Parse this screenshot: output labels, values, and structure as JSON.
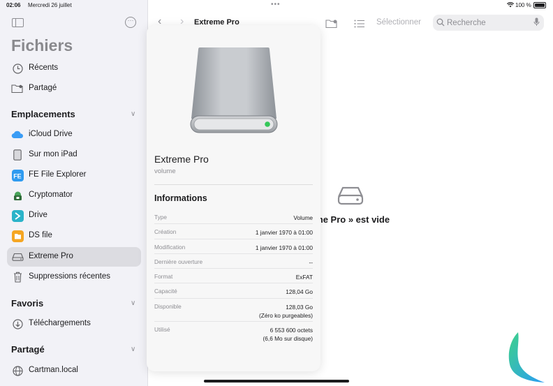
{
  "status": {
    "time": "02:06",
    "date": "Mercredi 26 juillet",
    "battery": "100 %",
    "battery_level": 1.0
  },
  "sidebar": {
    "title": "Fichiers",
    "top_items": [
      {
        "label": "Récents",
        "icon": "clock-icon"
      },
      {
        "label": "Partagé",
        "icon": "shared-folder-icon"
      }
    ],
    "sections": {
      "locations": {
        "title": "Emplacements",
        "items": [
          {
            "label": "iCloud Drive",
            "icon": "icloud-icon"
          },
          {
            "label": "Sur mon iPad",
            "icon": "ipad-icon"
          },
          {
            "label": "FE File Explorer",
            "icon": "fe-app-icon"
          },
          {
            "label": "Cryptomator",
            "icon": "cryptomator-icon"
          },
          {
            "label": "Drive",
            "icon": "drive-app-icon"
          },
          {
            "label": "DS file",
            "icon": "ds-file-icon"
          },
          {
            "label": "Extreme Pro",
            "icon": "external-drive-icon",
            "selected": true
          },
          {
            "label": "Suppressions récentes",
            "icon": "trash-icon"
          }
        ]
      },
      "favorites": {
        "title": "Favoris",
        "items": [
          {
            "label": "Téléchargements",
            "icon": "download-icon"
          }
        ]
      },
      "shared": {
        "title": "Partagé",
        "items": [
          {
            "label": "Cartman.local",
            "icon": "network-icon"
          }
        ]
      }
    }
  },
  "toolbar": {
    "title": "Extreme Pro",
    "select_label": "Sélectionner",
    "search_placeholder": "Recherche"
  },
  "main": {
    "empty_message": "eme Pro » est vide"
  },
  "popover": {
    "name": "Extreme Pro",
    "kind": "volume",
    "info_title": "Informations",
    "rows": [
      {
        "key": "Type",
        "value": "Volume"
      },
      {
        "key": "Création",
        "value": "1 janvier 1970 à 01:00"
      },
      {
        "key": "Modification",
        "value": "1 janvier 1970 à 01:00"
      },
      {
        "key": "Dernière ouverture",
        "value": "--"
      },
      {
        "key": "Format",
        "value": "ExFAT"
      },
      {
        "key": "Capacité",
        "value": "128,04 Go"
      },
      {
        "key": "Disponible",
        "value": "128,03 Go",
        "value2": "(Zéro ko purgeables)"
      },
      {
        "key": "Utilisé",
        "value": "6 553 600 octets",
        "value2": "(6,6 Mo sur disque)"
      }
    ]
  },
  "colors": {
    "accent": "#007aff",
    "drive_led": "#34c759",
    "logo_green": "#3fd18a",
    "logo_blue": "#2a9df4"
  }
}
